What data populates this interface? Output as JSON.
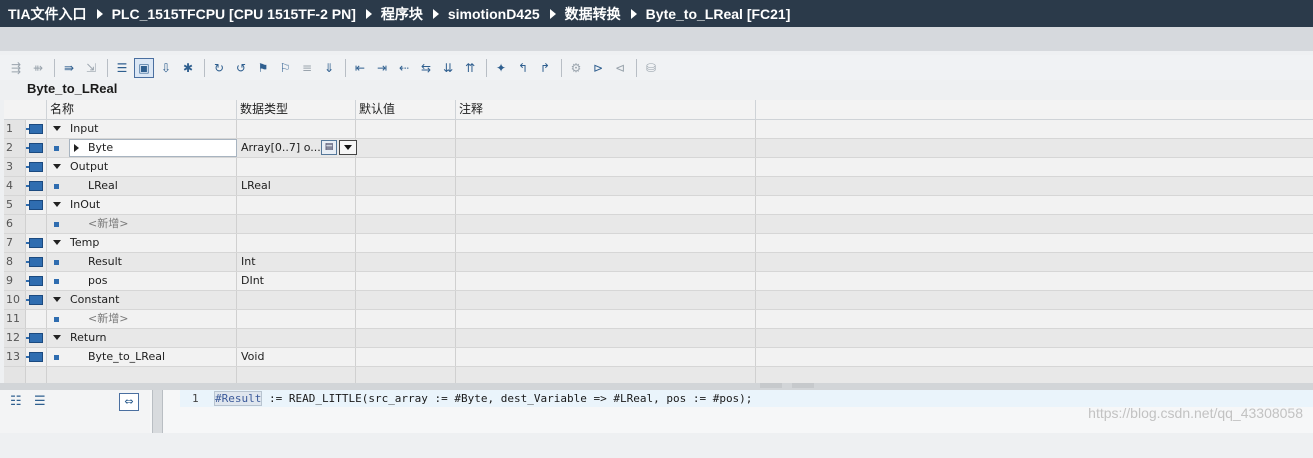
{
  "breadcrumb": [
    "TIA文件入口",
    "PLC_1515TFCPU [CPU 1515TF-2 PN]",
    "程序块",
    "simotionD425",
    "数据转换",
    "Byte_to_LReal [FC21]"
  ],
  "block_title": "Byte_to_LReal",
  "columns": {
    "name": "名称",
    "data_type": "数据类型",
    "default_value": "默认值",
    "comment": "注释"
  },
  "rows": [
    {
      "num": "1",
      "name": "Input",
      "type": "",
      "level": "section"
    },
    {
      "num": "2",
      "name": "Byte",
      "type": "Array[0..7] o...",
      "level": "item-expandable"
    },
    {
      "num": "3",
      "name": "Output",
      "type": "",
      "level": "section"
    },
    {
      "num": "4",
      "name": "LReal",
      "type": "LReal",
      "level": "item"
    },
    {
      "num": "5",
      "name": "InOut",
      "type": "",
      "level": "section"
    },
    {
      "num": "6",
      "name": "<新增>",
      "type": "",
      "level": "new"
    },
    {
      "num": "7",
      "name": "Temp",
      "type": "",
      "level": "section"
    },
    {
      "num": "8",
      "name": "Result",
      "type": "Int",
      "level": "item"
    },
    {
      "num": "9",
      "name": "pos",
      "type": "DInt",
      "level": "item"
    },
    {
      "num": "10",
      "name": "Constant",
      "type": "",
      "level": "section"
    },
    {
      "num": "11",
      "name": "<新增>",
      "type": "",
      "level": "new"
    },
    {
      "num": "12",
      "name": "Return",
      "type": "",
      "level": "section"
    },
    {
      "num": "13",
      "name": "Byte_to_LReal",
      "type": "Void",
      "level": "item"
    }
  ],
  "code": {
    "line_number": "1",
    "var_result": "#Result",
    "statement": " := READ_LITTLE(src_array := #Byte, dest_Variable => #LReal, pos := #pos);"
  },
  "watermark": "https://blog.csdn.net/qq_43308058",
  "colors": {
    "titlebar": "#2b3a4a",
    "accent": "#2f6db0"
  }
}
